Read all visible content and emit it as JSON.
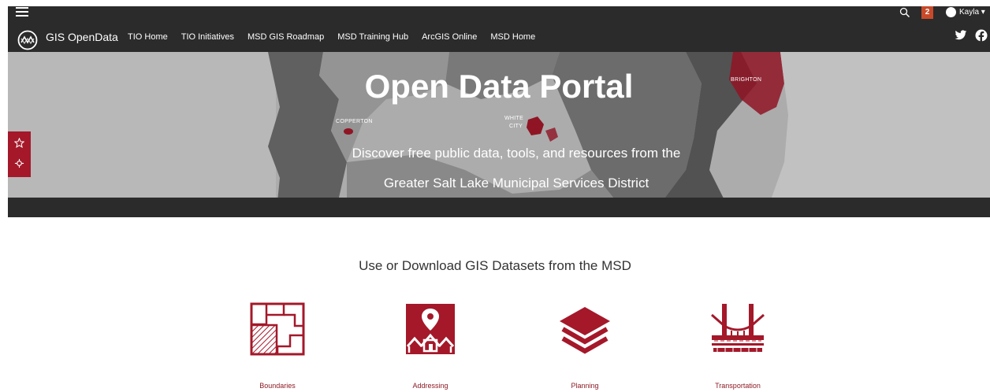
{
  "header": {
    "site_title": "GIS OpenData",
    "nav_items": [
      "TIO Home",
      "TIO Initiatives",
      "MSD GIS Roadmap",
      "MSD Training Hub",
      "ArcGIS Online",
      "MSD Home"
    ],
    "notification_count": "2",
    "user_name": "Kayla ▾"
  },
  "hero": {
    "title": "Open Data Portal",
    "subtitle_line1": "Discover free public data, tools, and resources from the",
    "subtitle_line2": "Greater Salt Lake Municipal Services District",
    "map_labels": [
      "COPPERTON",
      "WHITE",
      "CITY",
      "BRIGHTON"
    ]
  },
  "section": {
    "heading": "Use or Download GIS Datasets from the MSD"
  },
  "tiles": [
    {
      "label": "Boundaries",
      "icon": "boundaries-icon"
    },
    {
      "label": "Addressing",
      "icon": "addressing-icon"
    },
    {
      "label": "Planning",
      "icon": "planning-icon"
    },
    {
      "label": "Transportation",
      "icon": "transportation-icon"
    }
  ],
  "colors": {
    "brand_red": "#a4182a",
    "header_bg": "#2b2b2b",
    "badge": "#c84a2a",
    "tile_label": "#8c1a24"
  }
}
